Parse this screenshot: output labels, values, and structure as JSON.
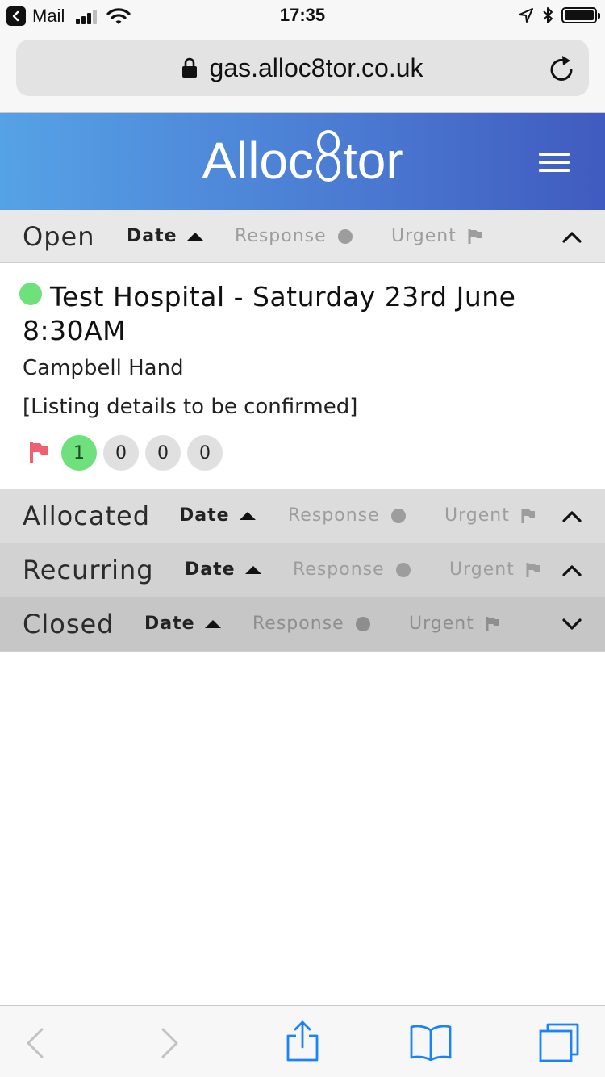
{
  "status_bar": {
    "back_app": "Mail",
    "time": "17:35"
  },
  "browser": {
    "url": "gas.alloc8tor.co.uk"
  },
  "app": {
    "logo_before": "Alloc",
    "logo_after": "tor"
  },
  "sort_labels": {
    "date": "Date",
    "response": "Response",
    "urgent": "Urgent"
  },
  "sections": {
    "open": {
      "title": "Open",
      "expanded": true
    },
    "allocated": {
      "title": "Allocated",
      "expanded": true
    },
    "recurring": {
      "title": "Recurring",
      "expanded": true
    },
    "closed": {
      "title": "Closed",
      "expanded": false
    }
  },
  "listing": {
    "status_color": "#6ee07c",
    "title": "Test Hospital - Saturday 23rd June 8:30AM",
    "person": "Campbell Hand",
    "details": "[Listing details to be confirmed]",
    "urgent": true,
    "counts": [
      "1",
      "0",
      "0",
      "0"
    ]
  },
  "colors": {
    "header_gradient_start": "#56a2e6",
    "header_gradient_end": "#405bbf",
    "open_bg": "#e8e8e8",
    "allocated_bg": "#dcdcdc",
    "recurring_bg": "#d2d2d2",
    "closed_bg": "#c6c6c6",
    "ios_blue": "#1a82fb",
    "urgent_red": "#f06070"
  },
  "icons": [
    "chevron-left-icon",
    "signal-icon",
    "wifi-icon",
    "location-icon",
    "bluetooth-icon",
    "battery-icon",
    "lock-icon",
    "reload-icon",
    "menu-icon",
    "triangle-up-icon",
    "dot-icon",
    "flag-icon",
    "chevron-up-icon",
    "chevron-down-icon",
    "back-icon",
    "forward-icon",
    "share-icon",
    "bookmarks-icon",
    "tabs-icon"
  ]
}
